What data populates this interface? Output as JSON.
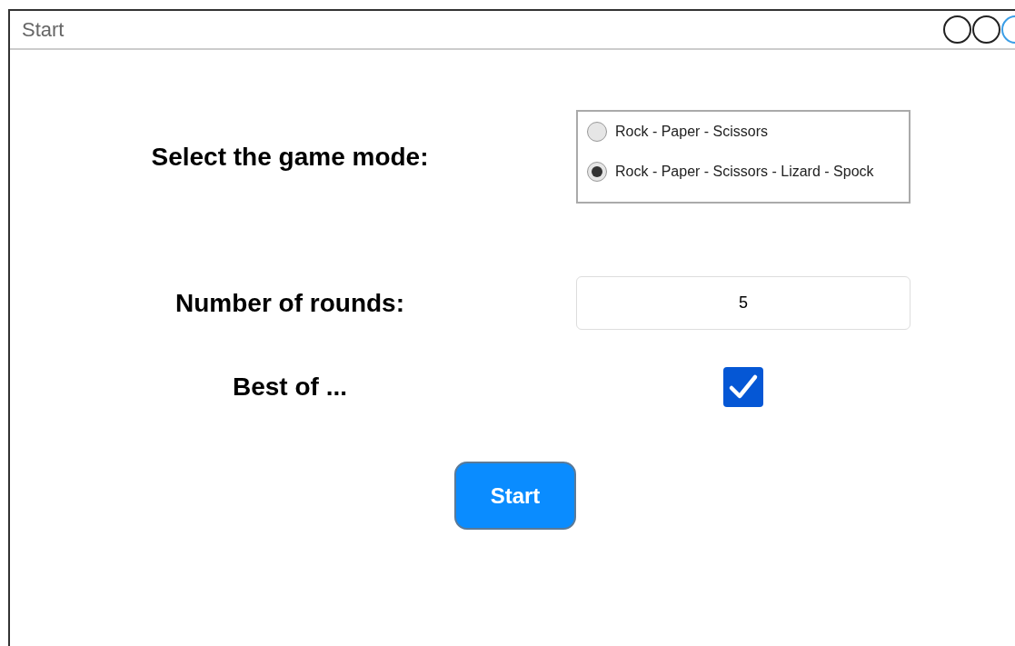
{
  "window": {
    "title": "Start"
  },
  "game_mode": {
    "label": "Select the game mode:",
    "options": [
      {
        "label": "Rock - Paper - Scissors",
        "selected": false
      },
      {
        "label": "Rock - Paper - Scissors - Lizard - Spock",
        "selected": true
      }
    ]
  },
  "rounds": {
    "label": "Number of rounds:",
    "value": "5"
  },
  "best_of": {
    "label": "Best of ...",
    "checked": true
  },
  "start_button": "Start"
}
